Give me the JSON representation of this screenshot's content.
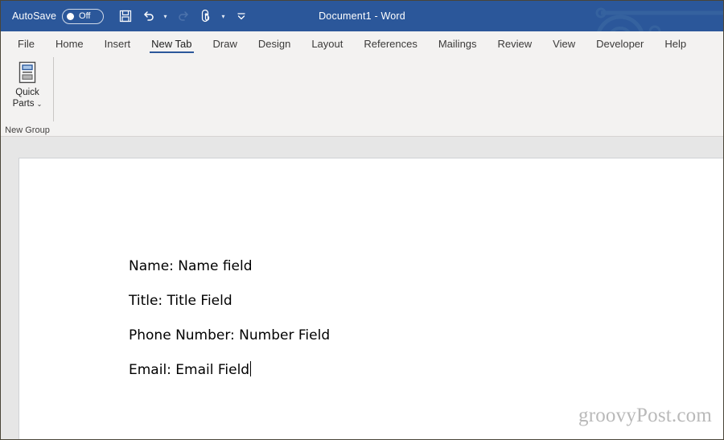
{
  "window": {
    "title": "Document1  -  Word",
    "titlebar_color": "#2b579a",
    "accent_color": "#2b579a"
  },
  "autosave": {
    "label": "AutoSave",
    "state": "Off",
    "enabled": false
  },
  "quick_access_toolbar": {
    "buttons": [
      {
        "name": "save-button",
        "icon": "save-icon",
        "enabled": true
      },
      {
        "name": "undo-button",
        "icon": "undo-icon",
        "enabled": true,
        "has_dropdown": true
      },
      {
        "name": "redo-button",
        "icon": "redo-icon",
        "enabled": false
      },
      {
        "name": "touch-mouse-mode-button",
        "icon": "touch-mode-icon",
        "enabled": true,
        "has_dropdown": true
      },
      {
        "name": "customize-qat-button",
        "icon": "overflow-caret-icon",
        "enabled": true
      }
    ]
  },
  "ribbon": {
    "tabs": [
      {
        "label": "File",
        "active": false
      },
      {
        "label": "Home",
        "active": false
      },
      {
        "label": "Insert",
        "active": false
      },
      {
        "label": "New Tab",
        "active": true
      },
      {
        "label": "Draw",
        "active": false
      },
      {
        "label": "Design",
        "active": false
      },
      {
        "label": "Layout",
        "active": false
      },
      {
        "label": "References",
        "active": false
      },
      {
        "label": "Mailings",
        "active": false
      },
      {
        "label": "Review",
        "active": false
      },
      {
        "label": "View",
        "active": false
      },
      {
        "label": "Developer",
        "active": false
      },
      {
        "label": "Help",
        "active": false
      }
    ],
    "groups": [
      {
        "name": "New Group",
        "buttons": [
          {
            "label_line1": "Quick",
            "label_line2": "Parts",
            "icon": "quick-parts-icon",
            "has_dropdown": true,
            "dropdown_glyph": "ˇ"
          }
        ]
      }
    ]
  },
  "document": {
    "lines": [
      "Name: Name field",
      "Title: Title Field",
      "Phone Number: Number Field",
      "Email: Email Field"
    ],
    "cursor_after_line_index": 3
  },
  "watermark": {
    "text": "groovyPost.com"
  }
}
